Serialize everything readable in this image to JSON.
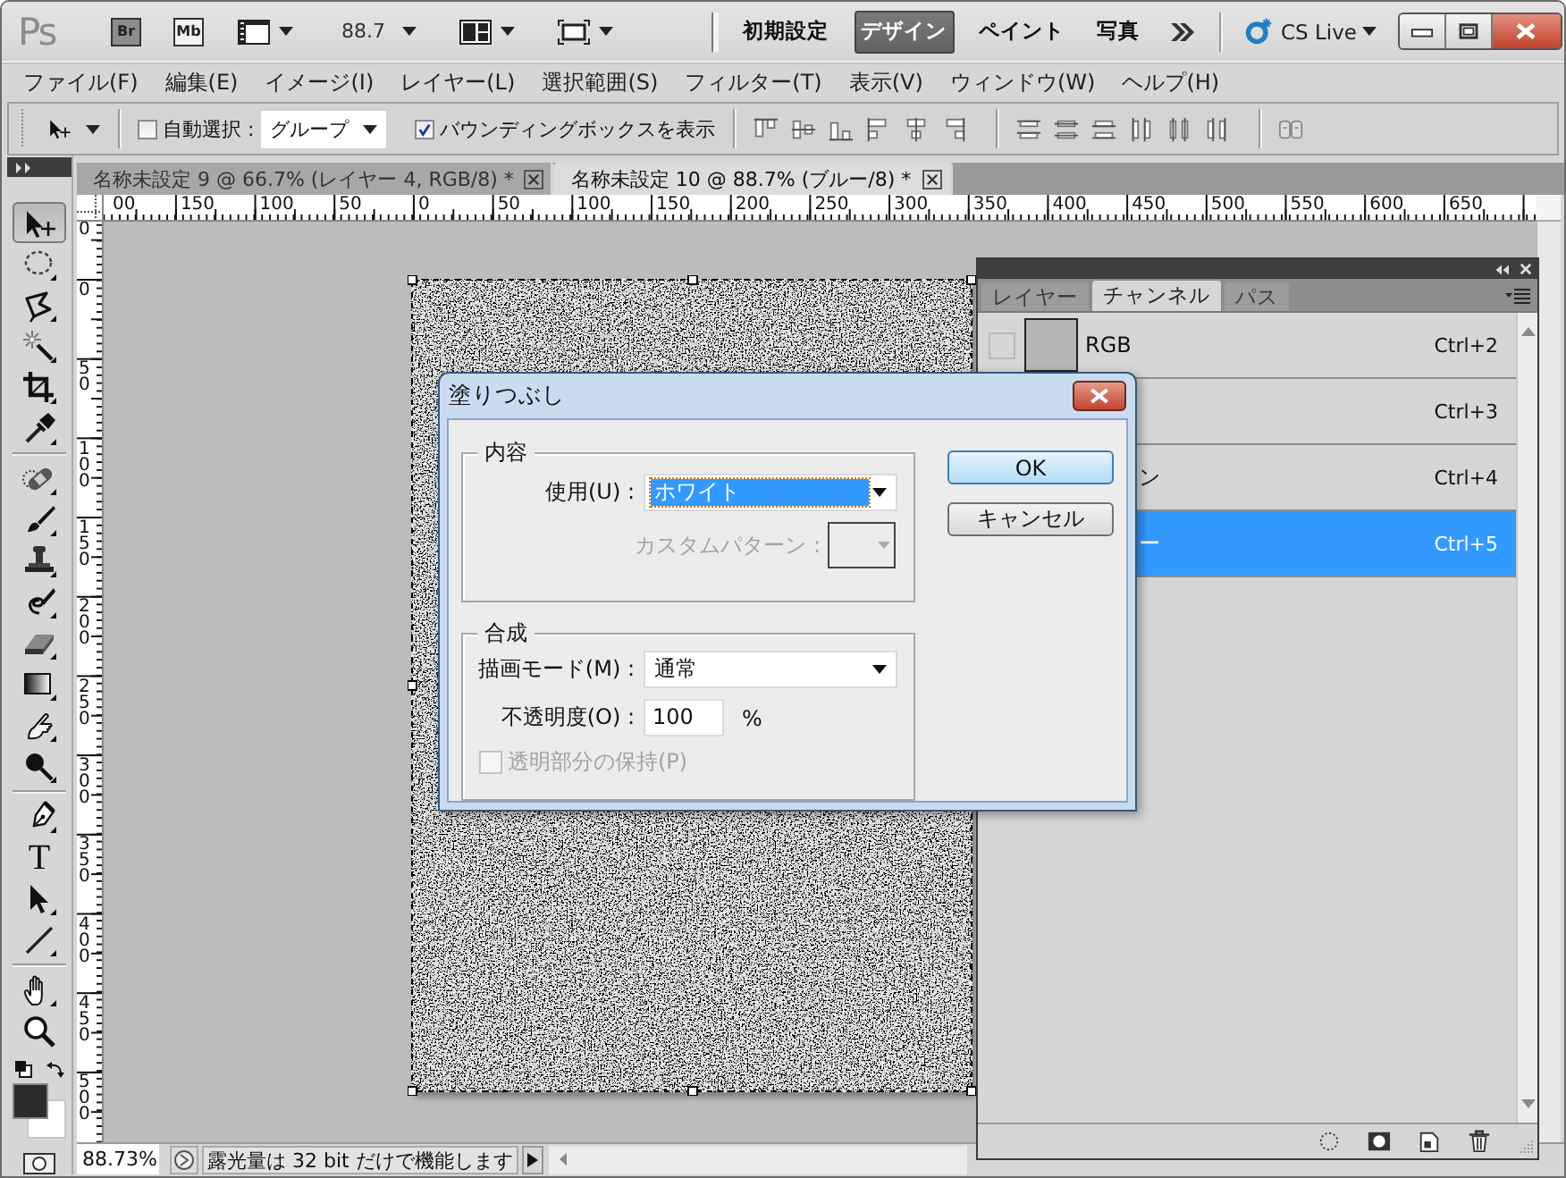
{
  "app_bar": {
    "logo": "Ps",
    "launchers": [
      "Br",
      "Mb"
    ],
    "zoom": "88.7",
    "workspaces": [
      {
        "label": "初期設定",
        "selected": false
      },
      {
        "label": "デザイン",
        "selected": true
      },
      {
        "label": "ペイント",
        "selected": false
      },
      {
        "label": "写真",
        "selected": false
      }
    ],
    "cs_live": "CS Live"
  },
  "menu": [
    "ファイル(F)",
    "編集(E)",
    "イメージ(I)",
    "レイヤー(L)",
    "選択範囲(S)",
    "フィルター(T)",
    "表示(V)",
    "ウィンドウ(W)",
    "ヘルプ(H)"
  ],
  "options_bar": {
    "auto_select": {
      "label": "自動選択 :",
      "checked": false
    },
    "auto_select_target": "グループ",
    "show_transform_controls": {
      "label": "バウンディングボックスを表示",
      "checked": true
    }
  },
  "document_tabs": [
    {
      "title": "名称未設定 9 @ 66.7% (レイヤー 4, RGB/8) *",
      "selected": false
    },
    {
      "title": "名称未設定 10 @ 88.7% (ブルー/8) *",
      "selected": true
    }
  ],
  "rulers": {
    "horizontal": [
      "00",
      "150",
      "100",
      "50",
      "0",
      "50",
      "100",
      "150",
      "200",
      "250",
      "300",
      "350",
      "400",
      "450",
      "500",
      "550",
      "600",
      "650"
    ],
    "vertical": [
      "0",
      "0",
      "50",
      "100",
      "150",
      "200",
      "250",
      "300",
      "350",
      "400",
      "450",
      "500"
    ]
  },
  "tools": [
    {
      "selected": true
    },
    {
      "selected": false
    },
    {
      "selected": false
    },
    {
      "selected": false
    },
    {
      "selected": false
    },
    {
      "selected": false
    },
    {
      "selected": false
    },
    {
      "selected": false
    },
    {
      "selected": false
    },
    {
      "selected": false
    },
    {
      "selected": false
    },
    {
      "selected": false
    },
    {
      "selected": false
    },
    {
      "selected": false
    },
    {
      "selected": false
    },
    {
      "selected": false,
      "glyph": "T"
    },
    {
      "selected": false
    },
    {
      "selected": false
    },
    {
      "selected": false
    },
    {
      "selected": false
    }
  ],
  "status_bar": {
    "zoom": "88.73%",
    "info": "露光量は 32 bit だけで機能します"
  },
  "channels_panel": {
    "tabs": [
      {
        "label": "レイヤー",
        "selected": false
      },
      {
        "label": "チャンネル",
        "selected": true
      },
      {
        "label": "パス",
        "selected": false
      }
    ],
    "channels": [
      {
        "kind": "full",
        "name": "RGB",
        "shortcut": "Ctrl+2",
        "visible": false,
        "selected": false
      },
      {
        "kind": "covered",
        "shortcut": "Ctrl+3",
        "selected": false
      },
      {
        "kind": "covered",
        "name": "ン",
        "shortcut": "Ctrl+4",
        "selected": false
      },
      {
        "kind": "covered",
        "name": "ー",
        "shortcut": "Ctrl+5",
        "selected": true
      }
    ]
  },
  "dialog": {
    "title": "塗りつぶし",
    "contents": {
      "legend": "内容",
      "use": {
        "label": "使用(U) :",
        "value": "ホワイト",
        "focused": true
      },
      "pattern": {
        "label": "カスタムパターン :",
        "disabled": true
      }
    },
    "blending": {
      "legend": "合成",
      "mode": {
        "label": "描画モード(M) :",
        "value": "通常"
      },
      "opacity": {
        "label": "不透明度(O) :",
        "value": "100",
        "unit": "%"
      },
      "preserve": {
        "label": "透明部分の保持(P)",
        "checked": false,
        "disabled": true
      }
    },
    "buttons": [
      {
        "label": "OK",
        "default": true
      },
      {
        "label": "キャンセル",
        "default": false
      }
    ]
  }
}
